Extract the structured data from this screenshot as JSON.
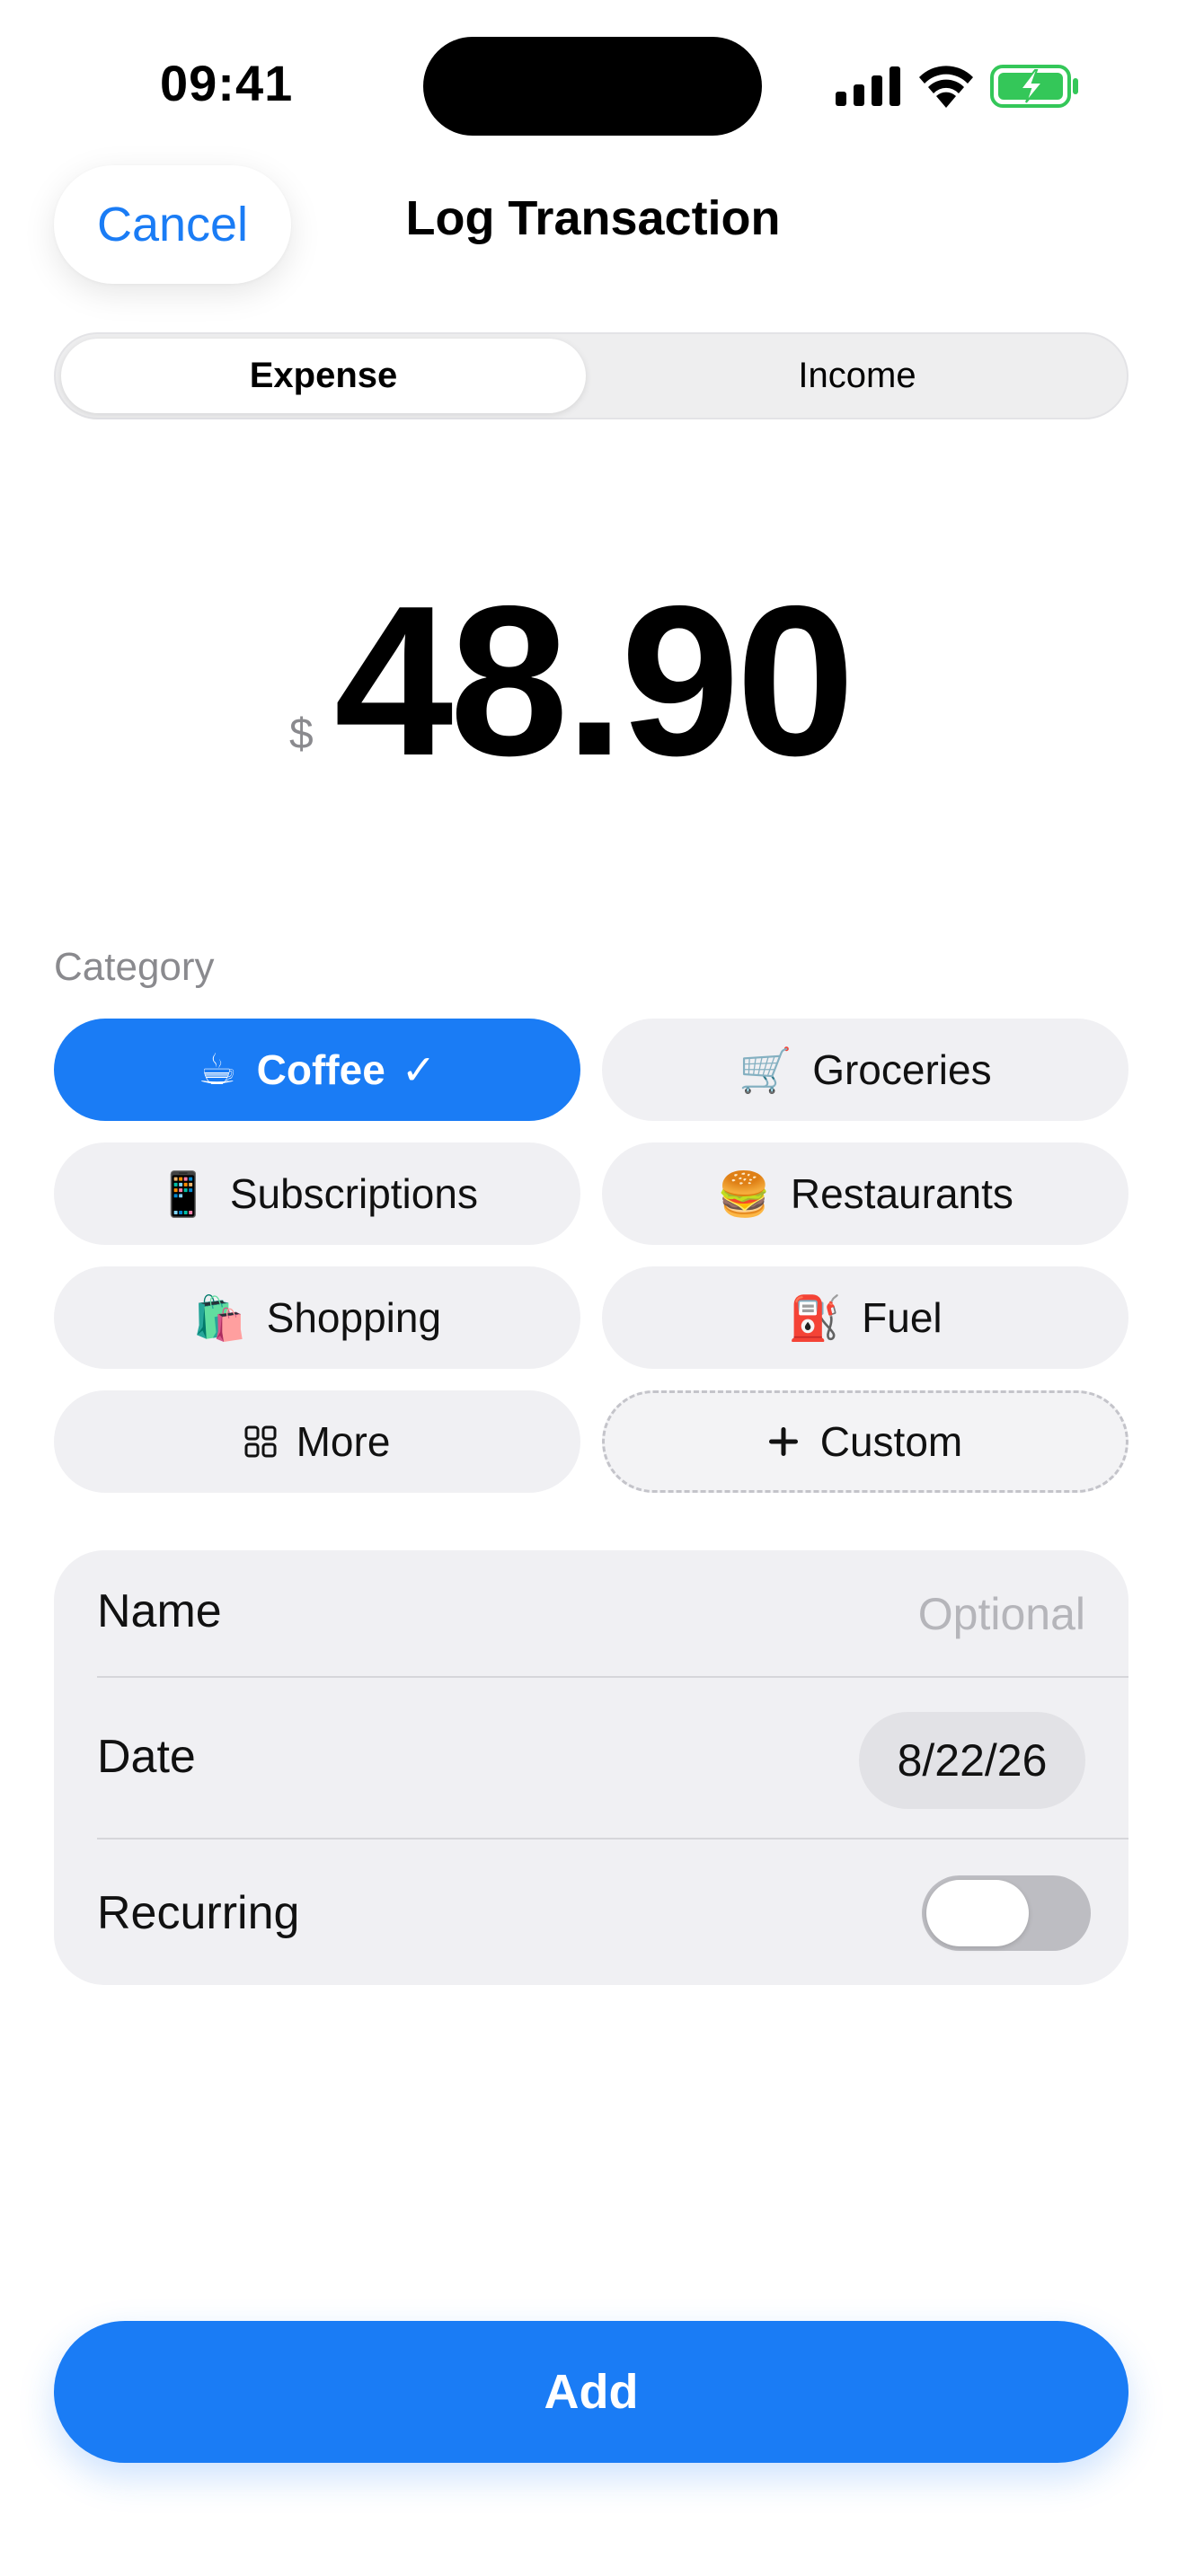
{
  "status_bar": {
    "time": "09:41",
    "icons": [
      "cellular-signal-icon",
      "wifi-icon",
      "battery-charging-icon"
    ],
    "battery_color": "#34c759"
  },
  "header": {
    "cancel_label": "Cancel",
    "title": "Log Transaction"
  },
  "type_toggle": {
    "options": [
      "Expense",
      "Income"
    ],
    "selected": "Expense"
  },
  "amount": {
    "currency_symbol": "$",
    "value": "48.90"
  },
  "category": {
    "label": "Category",
    "chips": [
      {
        "emoji": "☕",
        "label": "Coffee",
        "check": "✓",
        "selected": true
      },
      {
        "emoji": "🛒",
        "label": "Groceries",
        "selected": false
      },
      {
        "emoji": "📱",
        "label": "Subscriptions",
        "selected": false
      },
      {
        "emoji": "🍔",
        "label": "Restaurants",
        "selected": false
      },
      {
        "emoji": "🛍️",
        "label": "Shopping",
        "selected": false
      },
      {
        "emoji": "⛽",
        "label": "Fuel",
        "selected": false
      },
      {
        "icon": "grid-icon",
        "label": "More",
        "selected": false
      },
      {
        "icon": "plus-icon",
        "label": "Custom",
        "selected": false
      }
    ]
  },
  "form": {
    "name_label": "Name",
    "name_placeholder": "Optional",
    "name_value": "",
    "date_label": "Date",
    "date_value": "8/22/26",
    "recurring_label": "Recurring",
    "recurring_on": false
  },
  "add_label": "Add",
  "colors": {
    "accent": "#1a7cf5",
    "chip_bg": "#f0f0f3",
    "secondary_text": "#8a8a8e"
  }
}
